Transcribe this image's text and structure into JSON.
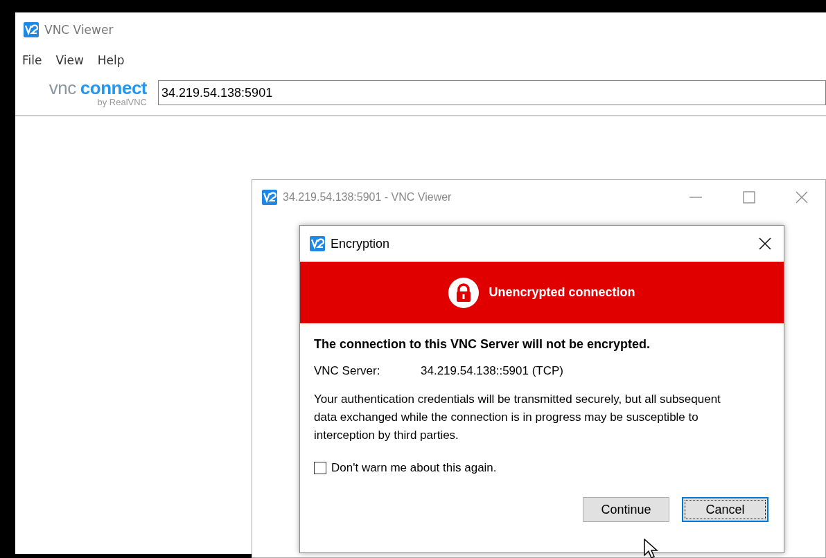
{
  "main_window": {
    "title": "VNC Viewer",
    "menu": [
      "File",
      "View",
      "Help"
    ],
    "logo": {
      "part_1": "vnc",
      "part_2": "connect",
      "byline": "by RealVNC"
    },
    "address_field": {
      "value": "34.219.54.138:5901"
    }
  },
  "session_window": {
    "title": "34.219.54.138:5901 - VNC Viewer"
  },
  "dialog": {
    "title": "Encryption",
    "banner": "Unencrypted connection",
    "heading": "The connection to this VNC Server will not be encrypted.",
    "server_label": "VNC Server:",
    "server_value": "34.219.54.138::5901 (TCP)",
    "message": "Your authentication credentials will be transmitted securely, but all subsequent data exchanged while the connection is in progress may be susceptible to interception by third parties.",
    "checkbox": {
      "label": "Don't warn me about this again.",
      "checked": false
    },
    "buttons": [
      {
        "label": "Continue",
        "focused": false
      },
      {
        "label": "Cancel",
        "focused": true
      }
    ]
  }
}
